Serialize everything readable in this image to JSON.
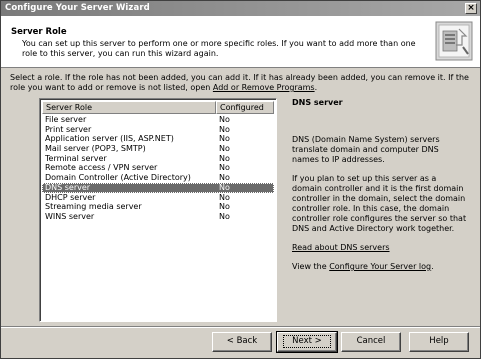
{
  "window": {
    "title": "Configure Your Server Wizard",
    "close_label": "×"
  },
  "header": {
    "title": "Server Role",
    "description": "You can set up this server to perform one or more specific roles. If you want to add more than one role to this server, you can run this wizard again.",
    "icon": "server-wizard-icon"
  },
  "instructions": {
    "text_before": "Select a role. If the role has not been added, you can add it. If it has already been added, you can remove it. If the role you want to add or remove is not listed, open ",
    "link": "Add or Remove Programs",
    "text_after": "."
  },
  "list": {
    "columns": [
      "Server Role",
      "Configured"
    ],
    "rows": [
      {
        "role": "File server",
        "configured": "No"
      },
      {
        "role": "Print server",
        "configured": "No"
      },
      {
        "role": "Application server (IIS, ASP.NET)",
        "configured": "No"
      },
      {
        "role": "Mail server (POP3, SMTP)",
        "configured": "No"
      },
      {
        "role": "Terminal server",
        "configured": "No"
      },
      {
        "role": "Remote access / VPN server",
        "configured": "No"
      },
      {
        "role": "Domain Controller (Active Directory)",
        "configured": "No"
      },
      {
        "role": "DNS server",
        "configured": "No"
      },
      {
        "role": "DHCP server",
        "configured": "No"
      },
      {
        "role": "Streaming media server",
        "configured": "No"
      },
      {
        "role": "WINS server",
        "configured": "No"
      }
    ],
    "selected_index": 7
  },
  "detail": {
    "title": "DNS server",
    "para1": "DNS (Domain Name System) servers translate domain and computer DNS names to IP addresses.",
    "para2": "If you plan to set up this server as a domain controller and it is the first domain controller in the domain, select the domain controller role. In this case, the domain controller role configures the server so that DNS and Active Directory work together.",
    "read_link": "Read about DNS servers",
    "log_prefix": "View the ",
    "log_link": "Configure Your Server log",
    "log_suffix": "."
  },
  "buttons": {
    "back": "< Back",
    "next": "Next >",
    "cancel": "Cancel",
    "help": "Help"
  }
}
